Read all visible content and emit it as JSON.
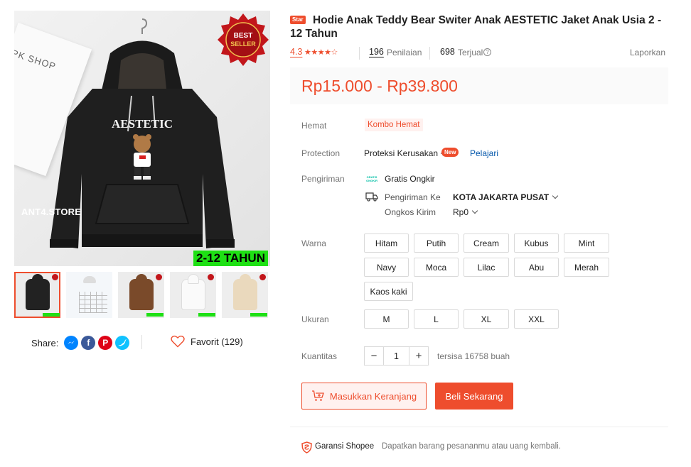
{
  "gallery": {
    "book_text": "PK SHOP",
    "store_watermark": "ANT4.STORE",
    "age_badge": "2-12 TAHUN",
    "best_seller_text": "BEST SELLER",
    "print_text": "AESTETIC",
    "thumbnail_colors": [
      "#222222",
      "#f4f4f4",
      "#7a4a2a",
      "#e8e8e8",
      "#ead9bd"
    ]
  },
  "share": {
    "label": "Share:",
    "icons": [
      "messenger-icon",
      "facebook-icon",
      "pinterest-icon",
      "twitter-icon"
    ]
  },
  "favorite": {
    "label": "Favorit (129)"
  },
  "product": {
    "badge": "Star",
    "title": "Hodie Anak Teddy Bear Switer Anak AESTETIC Jaket Anak Usia 2 - 12 Tahun",
    "rating": "4.3",
    "rating_stars": 4.3,
    "ratings_count": "196",
    "ratings_label": "Penilaian",
    "sold_count": "698",
    "sold_label": "Terjual",
    "report": "Laporkan",
    "price": "Rp15.000 - Rp39.800"
  },
  "details": {
    "hemat_label": "Hemat",
    "hemat_value": "Kombo Hemat",
    "protection_label": "Protection",
    "protection_value": "Proteksi Kerusakan +",
    "new_badge": "New",
    "learn": "Pelajari",
    "shipping_label": "Pengiriman",
    "free_ship_icon_text": "GRATIS ONGKIR",
    "free_ship": "Gratis Ongkir",
    "ship_to_label": "Pengiriman Ke",
    "ship_to_value": "KOTA JAKARTA PUSAT",
    "ship_cost_label": "Ongkos Kirim",
    "ship_cost_value": "Rp0"
  },
  "variants": {
    "color_label": "Warna",
    "colors": [
      "Hitam",
      "Putih",
      "Cream",
      "Kubus",
      "Mint",
      "Navy",
      "Moca",
      "Lilac",
      "Abu",
      "Merah",
      "Kaos kaki"
    ],
    "size_label": "Ukuran",
    "sizes": [
      "M",
      "L",
      "XL",
      "XXL"
    ]
  },
  "quantity": {
    "label": "Kuantitas",
    "minus": "−",
    "value": "1",
    "plus": "+",
    "stock": "tersisa 16758 buah"
  },
  "actions": {
    "add_to_cart": "Masukkan Keranjang",
    "buy_now": "Beli Sekarang"
  },
  "guarantee": {
    "title": "Garansi Shopee",
    "desc": "Dapatkan barang pesananmu atau uang kembali."
  },
  "colors": {
    "accent": "#ee4d2d",
    "link": "#0055aa"
  }
}
